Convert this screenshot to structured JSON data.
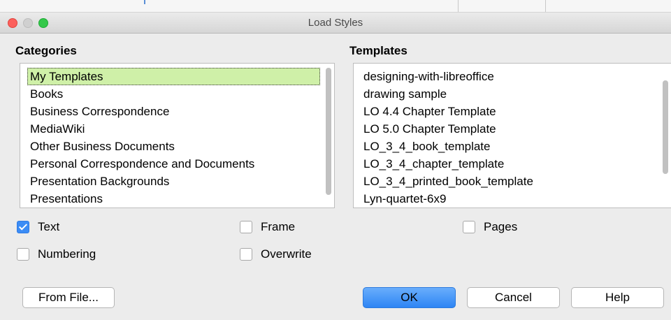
{
  "window": {
    "title": "Load Styles"
  },
  "categories": {
    "label": "Categories",
    "items": [
      "My Templates",
      "Books",
      "Business Correspondence",
      "MediaWiki",
      "Other Business Documents",
      "Personal Correspondence and Documents",
      "Presentation Backgrounds",
      "Presentations"
    ],
    "selected_index": 0
  },
  "templates": {
    "label": "Templates",
    "items": [
      "designing-with-libreoffice",
      "drawing sample",
      "LO 4.4 Chapter Template",
      "LO 5.0 Chapter Template",
      "LO_3_4_book_template",
      "LO_3_4_chapter_template",
      "LO_3_4_printed_book_template",
      "Lyn-quartet-6x9"
    ]
  },
  "options": {
    "text": {
      "label": "Text",
      "checked": true
    },
    "frame": {
      "label": "Frame",
      "checked": false
    },
    "pages": {
      "label": "Pages",
      "checked": false
    },
    "numbering": {
      "label": "Numbering",
      "checked": false
    },
    "overwrite": {
      "label": "Overwrite",
      "checked": false
    }
  },
  "buttons": {
    "from_file": "From File...",
    "ok": "OK",
    "cancel": "Cancel",
    "help": "Help"
  },
  "colors": {
    "selection": "#cff0a8",
    "primary_button": "#2e85f4",
    "checkbox_checked": "#3b8cf5"
  }
}
